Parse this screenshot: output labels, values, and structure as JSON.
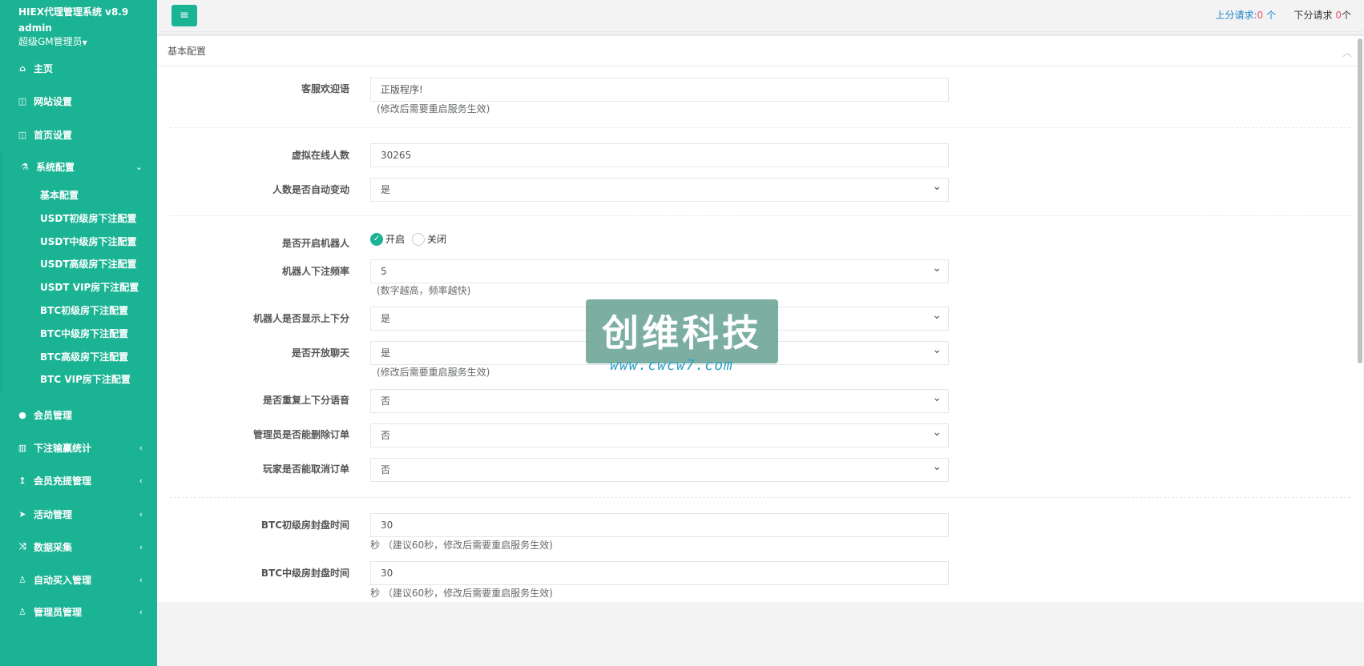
{
  "sidebar": {
    "app_title": "HIEX代理管理系统 v8.9",
    "username": "admin",
    "role": "超级GM管理员",
    "items": [
      {
        "label": "主页",
        "icon": "home-icon"
      },
      {
        "label": "网站设置",
        "icon": "columns-icon"
      },
      {
        "label": "首页设置",
        "icon": "columns-icon"
      },
      {
        "label": "系统配置",
        "icon": "flask-icon"
      },
      {
        "label": "会员管理",
        "icon": "user-icon"
      },
      {
        "label": "下注输赢统计",
        "icon": "bar-chart-icon"
      },
      {
        "label": "会员充提管理",
        "icon": "level-up-icon"
      },
      {
        "label": "活动管理",
        "icon": "paper-plane-icon"
      },
      {
        "label": "数据采集",
        "icon": "random-icon"
      },
      {
        "label": "自动买入管理",
        "icon": "male-icon"
      },
      {
        "label": "管理员管理",
        "icon": "male-icon"
      }
    ],
    "sub_items": [
      "基本配置",
      "USDT初级房下注配置",
      "USDT中级房下注配置",
      "USDT高级房下注配置",
      "USDT VIP房下注配置",
      "BTC初级房下注配置",
      "BTC中级房下注配置",
      "BTC高级房下注配置",
      "BTC VIP房下注配置"
    ]
  },
  "topbar": {
    "up_label": "上分请求:",
    "up_count": "0",
    "up_unit": " 个",
    "down_label": "下分请求 ",
    "down_count": "0",
    "down_unit": "个"
  },
  "panel": {
    "title": "基本配置",
    "fields": {
      "welcome": {
        "label": "客服欢迎语",
        "value": "正版程序!",
        "help": "(修改后需要重启服务生效)"
      },
      "online": {
        "label": "虚拟在线人数",
        "value": "30265"
      },
      "auto_change": {
        "label": "人数是否自动变动",
        "value": "是"
      },
      "robot": {
        "label": "是否开启机器人",
        "on": "开启",
        "off": "关闭"
      },
      "robot_freq": {
        "label": "机器人下注频率",
        "value": "5",
        "help": "(数字越高，频率越快)"
      },
      "robot_show": {
        "label": "机器人是否显示上下分",
        "value": "是"
      },
      "chat": {
        "label": "是否开放聊天",
        "value": "是",
        "help": "(修改后需要重启服务生效)"
      },
      "repeat_voice": {
        "label": "是否重复上下分语音",
        "value": "否"
      },
      "admin_delete": {
        "label": "管理员是否能删除订单",
        "value": "否"
      },
      "player_cancel": {
        "label": "玩家是否能取消订单",
        "value": "否"
      },
      "btc_junior": {
        "label": "BTC初级房封盘时间",
        "value": "30",
        "help": "秒  （建议60秒，修改后需要重启服务生效)"
      },
      "btc_mid": {
        "label": "BTC中级房封盘时间",
        "value": "30",
        "help": "秒  （建议60秒，修改后需要重启服务生效)"
      }
    }
  },
  "watermark": {
    "text": "创维科技",
    "url": "www.cwcw7.com"
  },
  "colors": {
    "primary": "#1ab394",
    "danger": "#ed5565",
    "link": "#1c84c6"
  }
}
